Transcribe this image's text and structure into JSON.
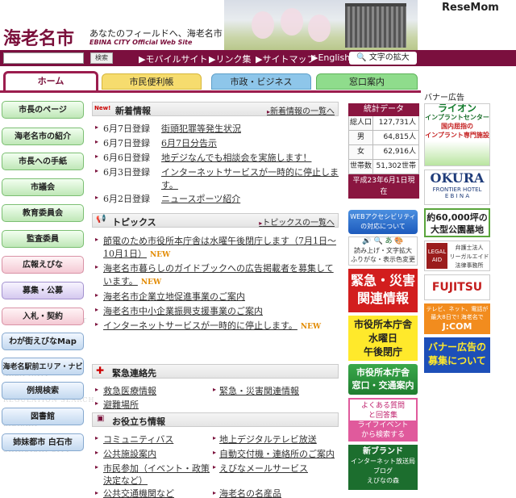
{
  "header": {
    "logo": "海老名市",
    "tagline": "あなたのフィールドへ、海老名市",
    "subtitle": "EBINA CITY Official Web Site",
    "watermark": "ReseMom"
  },
  "navbar": {
    "search_button": "検索",
    "links": [
      "▶モバイルサイト",
      "▶リンク集",
      "▶サイトマップ",
      "▶English"
    ],
    "text_size": "文字の拡大"
  },
  "tabs": [
    "ホーム",
    "市民便利帳",
    "市政・ビジネス",
    "窓口案内"
  ],
  "sidebar": {
    "items": [
      {
        "label": "市長のページ",
        "style": "green",
        "ghost": ""
      },
      {
        "label": "海老名市の紹介",
        "style": "green",
        "ghost": ""
      },
      {
        "label": "市長への手紙",
        "style": "green",
        "ghost": ""
      },
      {
        "label": "市議会",
        "style": "green",
        "ghost": "CITY COUNCIL"
      },
      {
        "label": "教育委員会",
        "style": "green",
        "ghost": "SCHOOL BOARD"
      },
      {
        "label": "監査委員",
        "style": "green",
        "ghost": "AUDIT COMMITTEE"
      },
      {
        "label": "広報えびな",
        "style": "pink",
        "ghost": "PUBLIC RELATIONS"
      },
      {
        "label": "募集・公募",
        "style": "purple",
        "ghost": "RECRUITMENT"
      },
      {
        "label": "入札・契約",
        "style": "pink",
        "ghost": "BID AND CONTRACT"
      },
      {
        "label": "わが街えびなMap",
        "style": "blue",
        "ghost": "EBINA MAP"
      },
      {
        "label": "海老名駅前エリア・ナビ",
        "style": "blue",
        "ghost": "AREA NAVI"
      },
      {
        "label": "例規検索",
        "style": "blue",
        "ghost": "REGULATION SEARCH"
      },
      {
        "label": "図書館",
        "style": "blue",
        "ghost": "LIBRARY"
      },
      {
        "label": "姉妹都市 白石市",
        "style": "blue",
        "ghost": "SHIROISHI CITY"
      }
    ]
  },
  "news": {
    "badge": "New!",
    "title": "新着情報",
    "more": "新着情報の一覧へ",
    "items": [
      {
        "date": "6月7日登録",
        "text": "街頭犯罪等発生状況"
      },
      {
        "date": "6月7日登録",
        "text": "6月7日分告示"
      },
      {
        "date": "6月6日登録",
        "text": "地デジなんでも相談会を実施します！"
      },
      {
        "date": "6月3日登録",
        "text": "インターネットサービスが一時的に停止します。"
      },
      {
        "date": "6月2日登録",
        "text": "ニュースポーツ紹介"
      }
    ]
  },
  "topics": {
    "title": "トピックス",
    "more": "トピックスの一覧へ",
    "new_label": "NEW",
    "items": [
      {
        "lines": [
          "節電のため市役所本庁舎は水曜午後閉庁します（7月1日～",
          "10月1日）"
        ],
        "new": true
      },
      {
        "lines": [
          "海老名市暮らしのガイドブックへの広告掲載者を募集して",
          "います。"
        ],
        "new": true
      },
      {
        "lines": [
          "海老名市企業立地促進事業のご案内"
        ],
        "new": false
      },
      {
        "lines": [
          "海老名市中小企業振興支援事業のご案内"
        ],
        "new": false
      },
      {
        "lines": [
          "インターネットサービスが一時的に停止します。"
        ],
        "new": true
      }
    ]
  },
  "emergency": {
    "title": "緊急連絡先",
    "links": [
      "救急医療情報",
      "緊急・災害関連情報",
      "避難場所"
    ]
  },
  "useful": {
    "title": "お役立ち情報",
    "links": [
      [
        "コミュニティバス",
        "地上デジタルテレビ放送"
      ],
      [
        "公共施設案内",
        "自動交付機・連絡所のご案内"
      ],
      [
        "市民参加（イベント・政策",
        "えびなメールサービス"
      ],
      [
        "決定など）",
        ""
      ],
      [
        "公共交通機関など",
        "海老名の名産品"
      ]
    ]
  },
  "stats": {
    "title": "統計データ",
    "rows": [
      [
        "総人口",
        "127,731人"
      ],
      [
        "男",
        "64,815人"
      ],
      [
        "女",
        "62,916人"
      ],
      [
        "世帯数",
        "51,302世帯"
      ]
    ],
    "footer": [
      "平成23年6月1日現",
      "在"
    ]
  },
  "mid_banners": {
    "web_access": [
      "WEBアクセシビリティ",
      "の対応について"
    ],
    "tool": [
      "読み上げ・文字拡大",
      "ふりがな・表示色変更"
    ],
    "emergency": [
      "緊急・災害",
      "関連情報"
    ],
    "closing": [
      "市役所本庁舎",
      "水曜日",
      "午後閉庁"
    ],
    "office": [
      "市役所本庁舎",
      "窓口・交通案内"
    ],
    "faq": [
      "よくある質問",
      "と回答集",
      "ライフイベント",
      "から検索する"
    ],
    "blog": [
      "新ブランド",
      "インターネット放送局",
      "ブログ",
      "えびなの森"
    ]
  },
  "ads": {
    "title": "バナー広告",
    "lion": [
      "ライオン",
      "インプラントセンター",
      "国内屈指の",
      "インプラント専門施設"
    ],
    "okura": [
      "OKURA",
      "FRONTIER HOTEL",
      "E B I N A"
    ],
    "cemetery": [
      "約60,000坪の",
      "大型公園墓地"
    ],
    "legal": [
      "LEGAL",
      "AID",
      "弁護士法人",
      "リーガルエイド",
      "法律事務所"
    ],
    "fujitsu": "FUJITSU",
    "jcom": [
      "テレビ、ネット、電話が",
      "最大8日で! 海老名で",
      "J:COM"
    ],
    "recruit": [
      "バナー広告の",
      "募集について"
    ]
  },
  "colors": {
    "brand": "#7b0f3e",
    "accent_new": "#e28a00"
  }
}
